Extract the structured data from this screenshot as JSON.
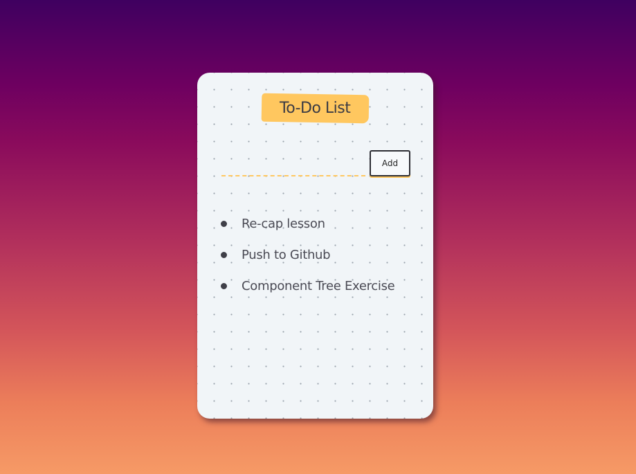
{
  "app": {
    "title": "To-Do List"
  },
  "form": {
    "input_value": "",
    "input_placeholder": "",
    "add_label": "Add"
  },
  "todos": [
    {
      "text": "Re-cap lesson"
    },
    {
      "text": "Push to Github"
    },
    {
      "text": "Component Tree Exercise"
    }
  ],
  "colors": {
    "accent": "#ffc75f",
    "card_background": "#f1f5f8",
    "text": "#4a4a54",
    "gradient_top": "#3f0060",
    "gradient_bottom": "#f69a66"
  }
}
